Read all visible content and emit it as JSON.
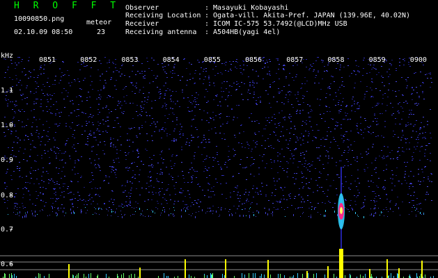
{
  "header": {
    "brand": "H R O F F T",
    "filename": "10090850.png",
    "datetime": "02.10.09 08:50",
    "meteor_label": "meteor",
    "meteor_count": "23",
    "info": [
      {
        "label": "Observer",
        "value": ": Masayuki Kobayashi"
      },
      {
        "label": "Receiving Location",
        "value": ": Ogata-vill. Akita-Pref. JAPAN (139.96E, 40.02N)"
      },
      {
        "label": "Receiver",
        "value": ": ICOM IC-575 53.7492(@LCD)MHz USB"
      },
      {
        "label": "Receiving antenna",
        "value": ": A504HB(yagi 4el)"
      }
    ]
  },
  "spectrogram": {
    "unit": "kHz",
    "time_ticks": [
      "0851",
      "0852",
      "0853",
      "0854",
      "0855",
      "0856",
      "0857",
      "0858",
      "0859",
      "0900"
    ],
    "freq_ticks": [
      "1.1",
      "1.0",
      "0.9",
      "0.8",
      "0.7",
      "0.6"
    ],
    "colors": {
      "background": "#000000",
      "grid": "#ffffff",
      "noise": "#3030c0",
      "signal": "#ffff00",
      "peak": "#ff0066"
    }
  }
}
